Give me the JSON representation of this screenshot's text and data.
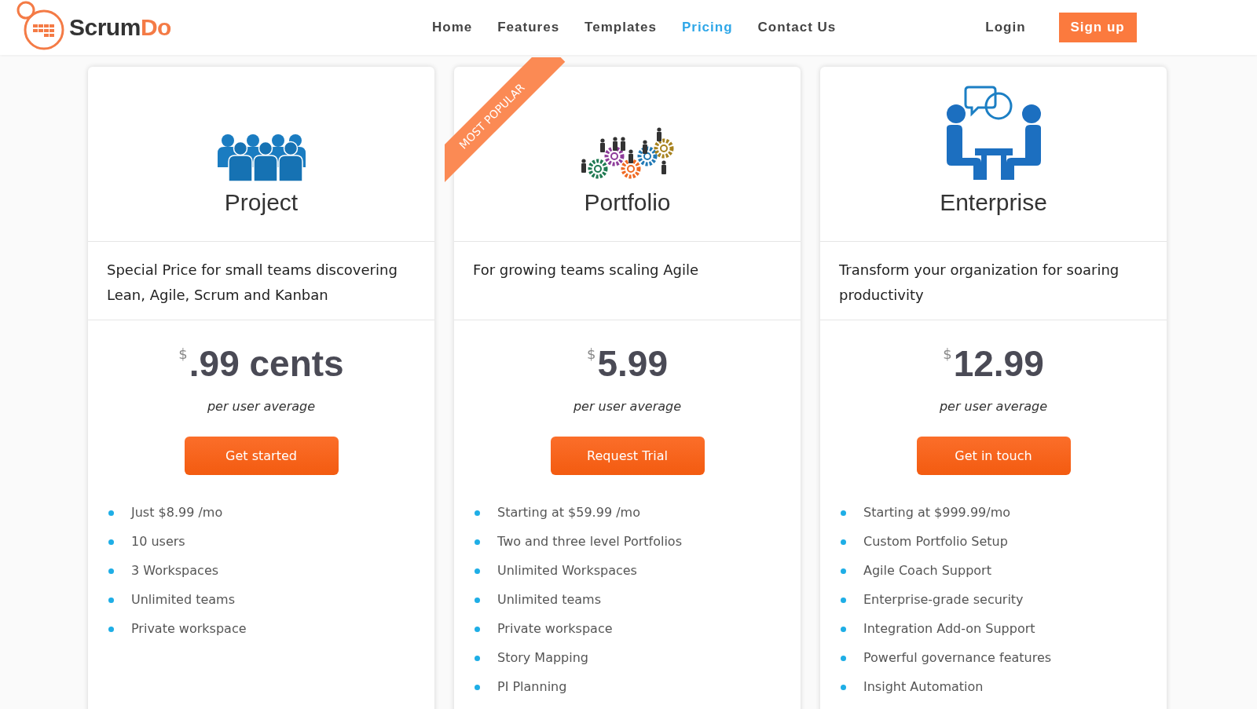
{
  "header": {
    "logo": {
      "brand_dark": "Scrum",
      "brand_accent": "Do"
    },
    "nav": [
      {
        "label": "Home",
        "selected": false
      },
      {
        "label": "Features",
        "selected": false
      },
      {
        "label": "Templates",
        "selected": false
      },
      {
        "label": "Pricing",
        "selected": true
      },
      {
        "label": "Contact Us",
        "selected": false
      }
    ],
    "login": "Login",
    "signup": "Sign up"
  },
  "plans": [
    {
      "kind": "team",
      "name": "Project",
      "popular": false,
      "description": "Special Price for small teams discovering Lean, Agile, Scrum and Kanban",
      "currency": "$",
      "amount": ".99 cents",
      "period": "per user average",
      "button": "Get started",
      "features": [
        "Just $8.99 /mo",
        "10 users",
        "3 Workspaces",
        "Unlimited teams",
        "Private workspace"
      ]
    },
    {
      "kind": "gears",
      "name": "Portfolio",
      "popular": true,
      "ribbon": "MOST POPULAR",
      "description": "For growing teams scaling Agile",
      "currency": "$",
      "amount": "5.99",
      "period": "per user average",
      "button": "Request Trial",
      "features": [
        "Starting at $59.99 /mo",
        "Two and three level Portfolios",
        "Unlimited Workspaces",
        "Unlimited teams",
        "Private workspace",
        "Story Mapping",
        "PI Planning"
      ]
    },
    {
      "kind": "meeting",
      "name": "Enterprise",
      "popular": false,
      "description": "Transform your organization for soaring productivity",
      "currency": "$",
      "amount": "12.99",
      "period": "per user average",
      "button": "Get in touch",
      "features": [
        "Starting at $999.99/mo",
        "Custom Portfolio Setup",
        "Agile Coach Support",
        "Enterprise-grade security",
        "Integration Add-on Support",
        "Powerful governance features",
        "Insight Automation"
      ]
    }
  ]
}
